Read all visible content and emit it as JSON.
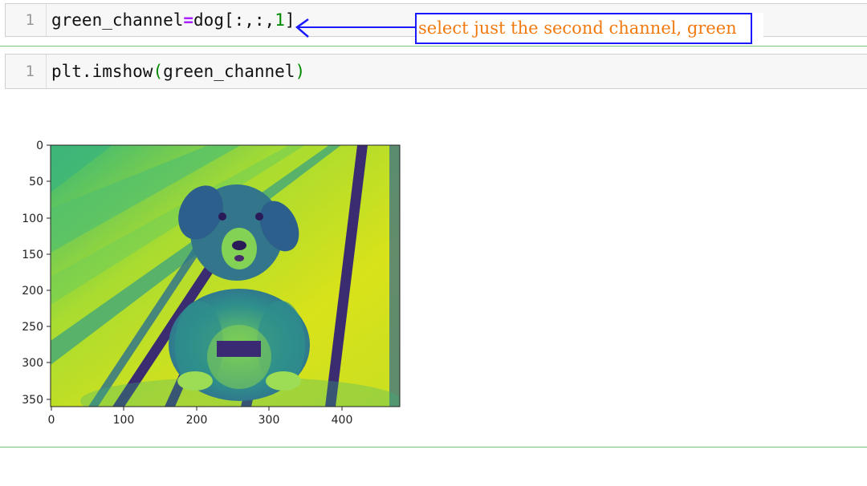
{
  "cells": [
    {
      "prompt": "1",
      "code": {
        "var": "green_channel",
        "op": "=",
        "head": "dog[:,:,",
        "num": "1",
        "tail": "]"
      }
    },
    {
      "prompt": "1",
      "code": {
        "func": "plt.imshow",
        "open": "(",
        "arg": "green_channel",
        "close": ")"
      }
    }
  ],
  "annotation": {
    "text": "select just the second channel, green",
    "box_color": "#1a1aff",
    "text_color": "#f07a10"
  },
  "output": {
    "image_desc_icon": "viridis-dog-image",
    "colormap": [
      "#440154",
      "#31688e",
      "#21918c",
      "#35b779",
      "#90d743",
      "#d9e21a"
    ],
    "axes": {
      "xlim": [
        0,
        480
      ],
      "ylim": [
        360,
        0
      ],
      "xticks": [
        "0",
        "100",
        "200",
        "300",
        "400"
      ],
      "yticks": [
        "0",
        "50",
        "100",
        "150",
        "200",
        "250",
        "300",
        "350"
      ]
    }
  }
}
